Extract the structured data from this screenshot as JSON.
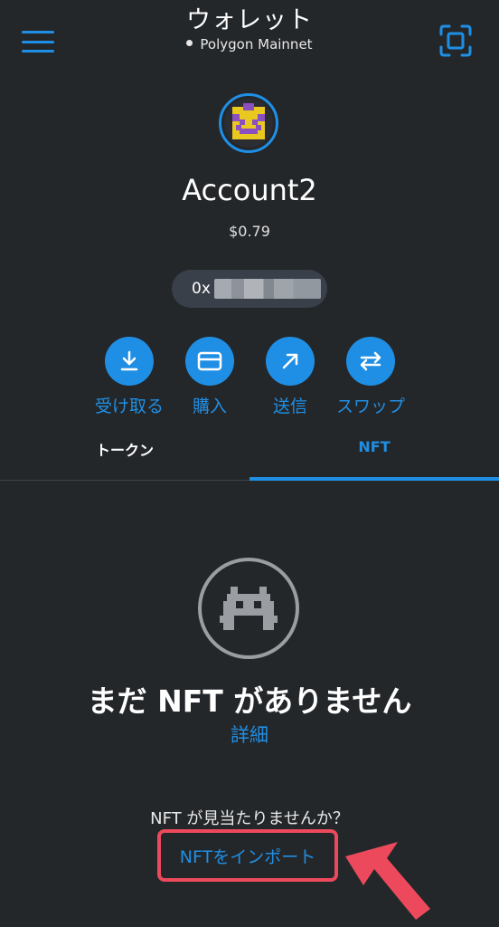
{
  "header": {
    "title": "ウォレット",
    "network": "Polygon Mainnet"
  },
  "account": {
    "name": "Account2",
    "balance": "$0.79",
    "address_prefix": "0x"
  },
  "actions": [
    {
      "label": "受け取る",
      "icon": "download-icon"
    },
    {
      "label": "購入",
      "icon": "card-icon"
    },
    {
      "label": "送信",
      "icon": "send-arrow-icon"
    },
    {
      "label": "スワップ",
      "icon": "swap-icon"
    }
  ],
  "tabs": {
    "token": "トークン",
    "nft": "NFT",
    "active": "nft"
  },
  "empty_state": {
    "title": "まだ NFT がありません",
    "details_link": "詳細",
    "not_found_text": "NFT が見当たりませんか？",
    "import_link": "NFTをインポート"
  },
  "colors": {
    "background": "#24272a",
    "accent": "#1f8fe5",
    "highlight": "#ec4a5c"
  }
}
